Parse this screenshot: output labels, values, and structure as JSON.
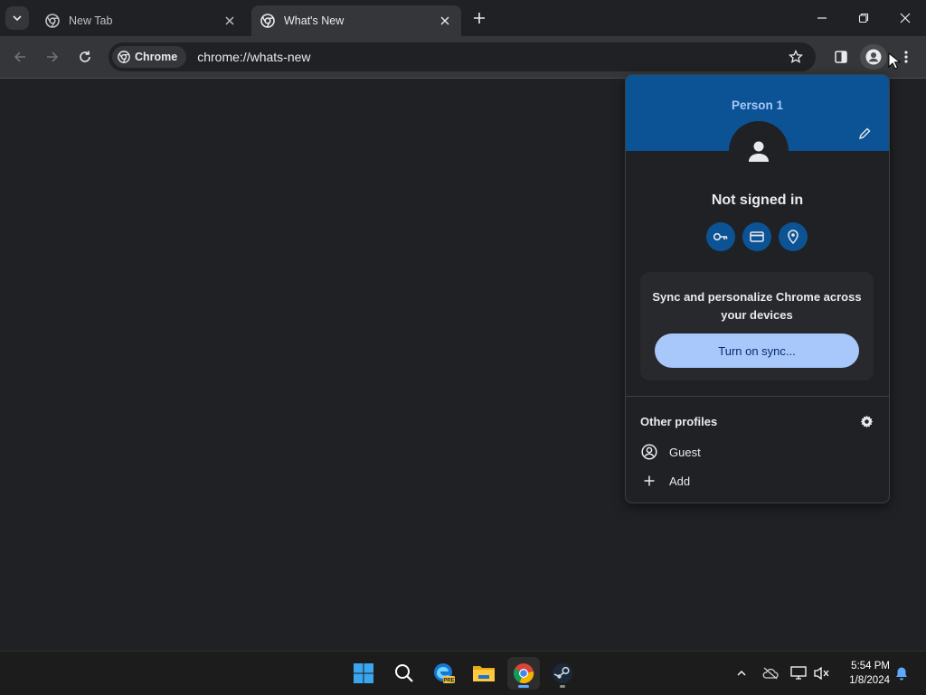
{
  "tabs": [
    {
      "title": "New Tab",
      "active": false
    },
    {
      "title": "What's New",
      "active": true
    }
  ],
  "omnibox": {
    "chip_label": "Chrome",
    "url": "chrome://whats-new"
  },
  "profile_menu": {
    "profile_name": "Person 1",
    "status": "Not signed in",
    "sync_message": "Sync and personalize Chrome across your devices",
    "sync_button": "Turn on sync...",
    "other_profiles_title": "Other profiles",
    "guest_label": "Guest",
    "add_label": "Add",
    "header_color": "#0b5394",
    "accent_color": "#a8c7fa"
  },
  "taskbar": {
    "time": "5:54 PM",
    "date": "1/8/2024",
    "apps": [
      "start-icon",
      "search-icon",
      "edge-beta-icon",
      "file-explorer-icon",
      "chrome-icon",
      "steam-icon"
    ]
  }
}
